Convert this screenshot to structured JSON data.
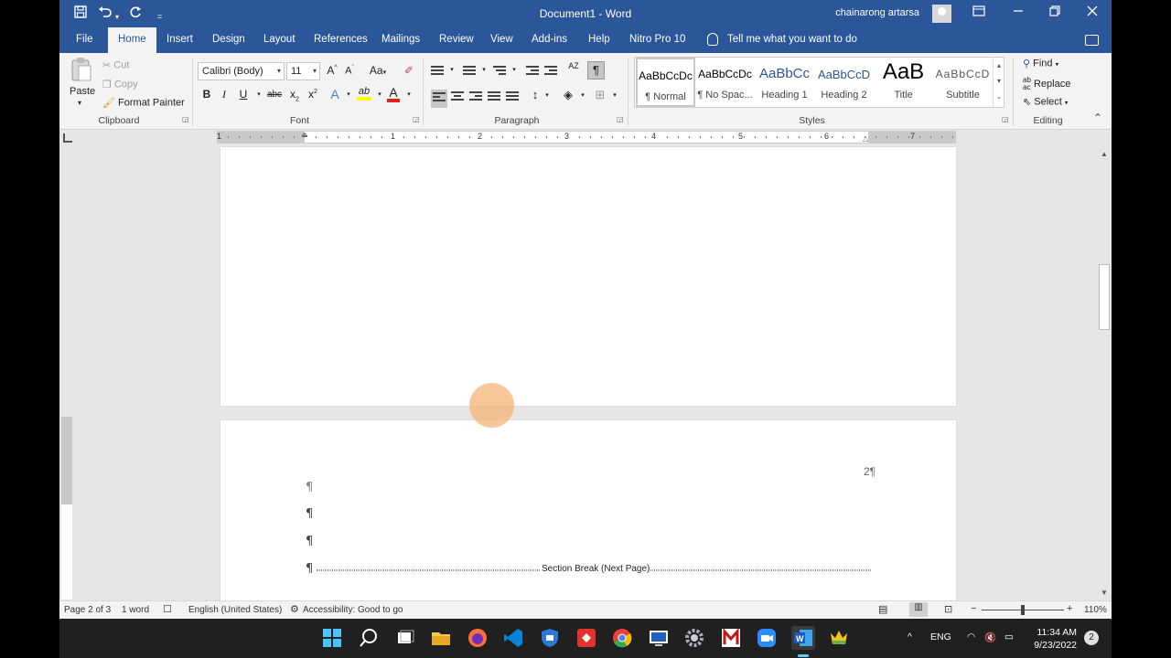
{
  "titlebar": {
    "doc_title": "Document1  -  Word",
    "user_name": "chainarong artarsa",
    "customize_label": "="
  },
  "tabs": [
    "File",
    "Home",
    "Insert",
    "Design",
    "Layout",
    "References",
    "Mailings",
    "Review",
    "View",
    "Add-ins",
    "Help",
    "Nitro Pro 10"
  ],
  "active_tab": "Home",
  "tell_me": "Tell me what you want to do",
  "clipboard": {
    "paste": "Paste",
    "cut": "Cut",
    "copy": "Copy",
    "format_painter": "Format Painter",
    "group_label": "Clipboard"
  },
  "font": {
    "name": "Calibri (Body)",
    "size": "11",
    "grow": "A",
    "shrink": "A",
    "change_case": "Aa",
    "bold": "B",
    "italic": "I",
    "underline": "U",
    "strikethrough": "abc",
    "subscript": "x",
    "superscript": "x",
    "text_effects": "A",
    "highlight": "ab",
    "font_color": "A",
    "group_label": "Font"
  },
  "paragraph": {
    "group_label": "Paragraph",
    "show_marks": "¶",
    "sort": "AZ"
  },
  "styles": {
    "group_label": "Styles",
    "items": [
      {
        "sample": "AaBbCcDc",
        "name": "¶ Normal"
      },
      {
        "sample": "AaBbCcDc",
        "name": "¶ No Spac..."
      },
      {
        "sample": "AaBbCc",
        "name": "Heading 1"
      },
      {
        "sample": "AaBbCcD",
        "name": "Heading 2"
      },
      {
        "sample": "AaB",
        "name": "Title"
      },
      {
        "sample": "AaBbCcD",
        "name": "Subtitle"
      }
    ]
  },
  "editing": {
    "find": "Find",
    "replace": "Replace",
    "select": "Select",
    "group_label": "Editing"
  },
  "ruler_numbers": [
    "1",
    "1",
    "2",
    "3",
    "4",
    "5",
    "6",
    "7"
  ],
  "document": {
    "page_number": "2¶",
    "pilcrow": "¶",
    "section_break": "Section Break (Next Page)"
  },
  "statusbar": {
    "page": "Page 2 of 3",
    "words": "1 word",
    "language": "English (United States)",
    "accessibility": "Accessibility: Good to go",
    "zoom": "110%",
    "zoom_minus": "−",
    "zoom_plus": "+"
  },
  "taskbar": {
    "lang": "ENG",
    "time": "11:34 AM",
    "date": "9/23/2022",
    "notifications": "2",
    "chevron": "^"
  },
  "colors": {
    "word_blue": "#2b579a",
    "ribbon_bg": "#f3f3f3",
    "taskbar_bg": "#202020"
  }
}
